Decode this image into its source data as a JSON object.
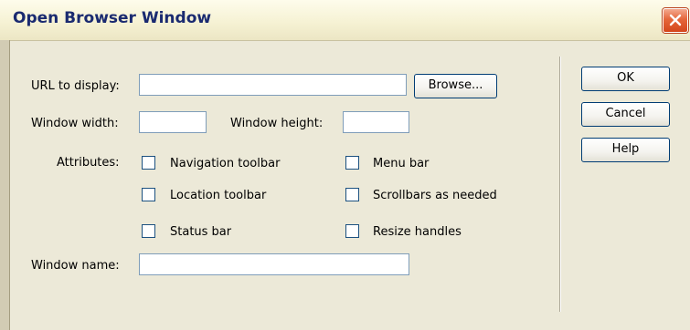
{
  "window": {
    "title": "Open Browser Window"
  },
  "form": {
    "url": {
      "label": "URL to display:",
      "value": "",
      "browse_label": "Browse..."
    },
    "width": {
      "label": "Window width:",
      "value": ""
    },
    "height": {
      "label": "Window height:",
      "value": ""
    },
    "attributes": {
      "label": "Attributes:",
      "items": [
        {
          "label": "Navigation toolbar",
          "checked": false
        },
        {
          "label": "Menu bar",
          "checked": false
        },
        {
          "label": "Location toolbar",
          "checked": false
        },
        {
          "label": "Scrollbars as needed",
          "checked": false
        },
        {
          "label": "Status bar",
          "checked": false
        },
        {
          "label": "Resize handles",
          "checked": false
        }
      ]
    },
    "name": {
      "label": "Window name:",
      "value": ""
    }
  },
  "buttons": {
    "ok": "OK",
    "cancel": "Cancel",
    "help": "Help"
  },
  "colors": {
    "dialog_bg": "#ece9d8",
    "title_text": "#1a2a70",
    "close_red": "#d4471c"
  }
}
